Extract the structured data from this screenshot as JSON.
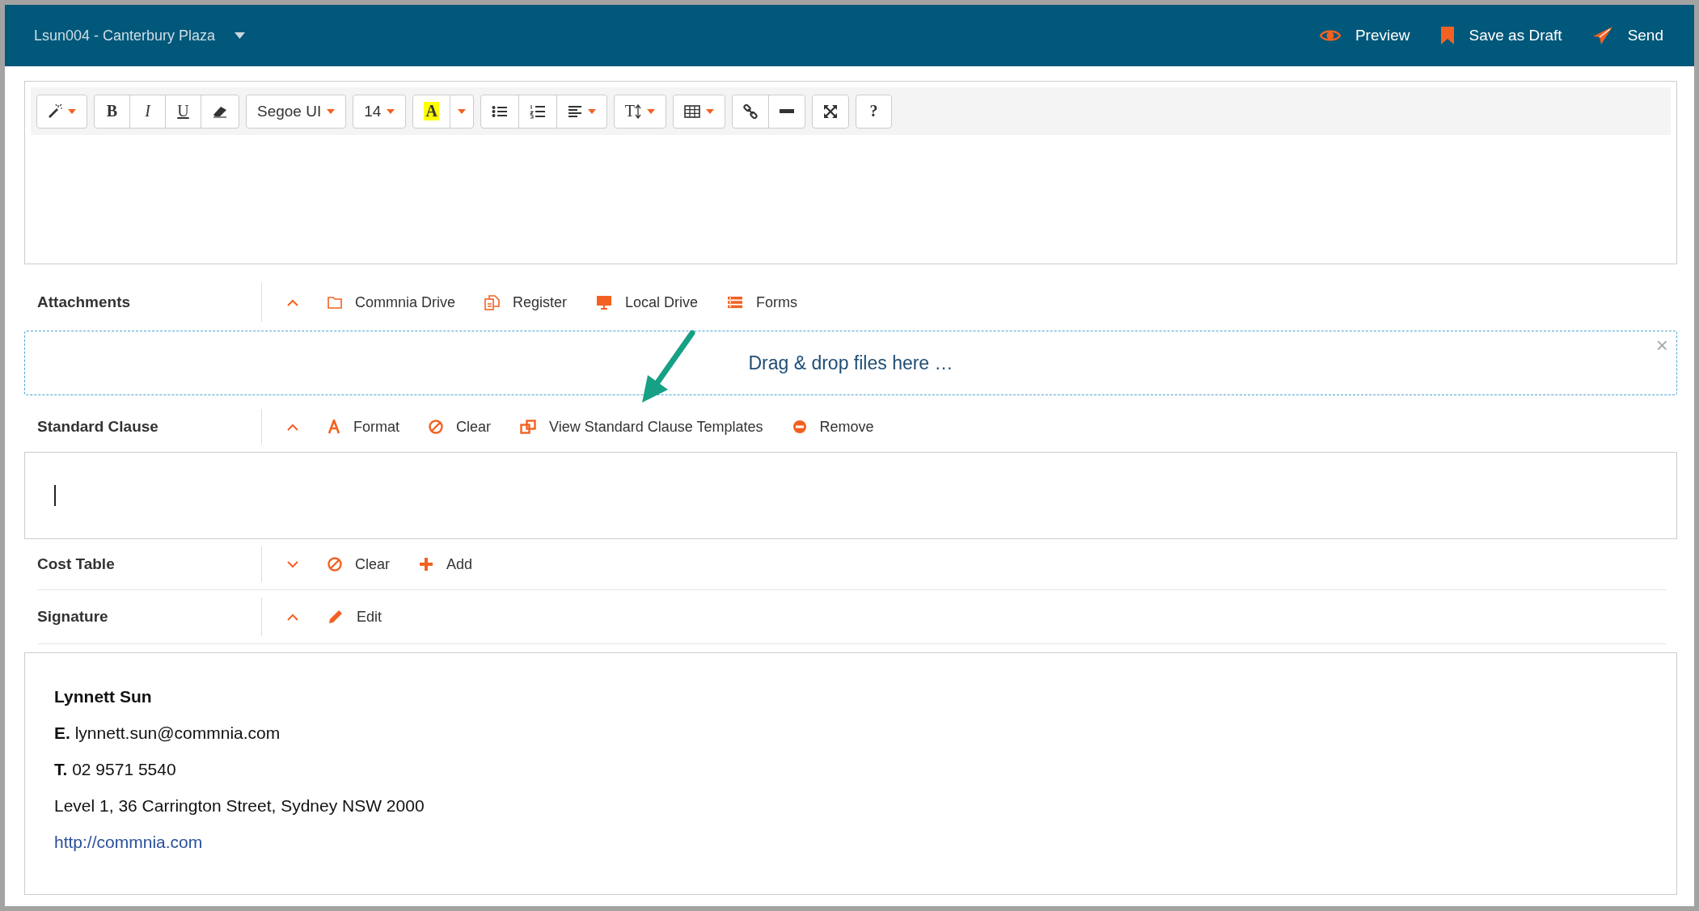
{
  "header": {
    "title": "Lsun004 - Canterbury Plaza",
    "actions": [
      {
        "kind": "preview",
        "label": "Preview"
      },
      {
        "kind": "draft",
        "label": "Save as Draft"
      },
      {
        "kind": "send",
        "label": "Send"
      }
    ]
  },
  "toolbar": [
    [
      {
        "kind": "magic",
        "dropdown": true
      }
    ],
    [
      {
        "kind": "bold",
        "label": "B"
      },
      {
        "kind": "italic",
        "label": "I"
      },
      {
        "kind": "underline",
        "label": "U"
      },
      {
        "kind": "eraser"
      }
    ],
    [
      {
        "kind": "font",
        "label": "Segoe UI",
        "dropdown": true
      }
    ],
    [
      {
        "kind": "size",
        "label": "14",
        "dropdown": true
      }
    ],
    [
      {
        "kind": "color",
        "label": "A",
        "color": "#ffff00"
      },
      {
        "kind": "caret"
      }
    ],
    [
      {
        "kind": "ul"
      },
      {
        "kind": "ol"
      },
      {
        "kind": "align",
        "dropdown": true
      }
    ],
    [
      {
        "kind": "lineheight",
        "label": "T",
        "dropdown": true
      }
    ],
    [
      {
        "kind": "table",
        "dropdown": true
      }
    ],
    [
      {
        "kind": "link"
      },
      {
        "kind": "hr"
      }
    ],
    [
      {
        "kind": "fullscreen"
      }
    ],
    [
      {
        "kind": "help",
        "label": "?"
      }
    ]
  ],
  "sections": [
    {
      "label": "Attachments",
      "expanded": true,
      "actions": [
        {
          "kind": "folder",
          "label": "Commnia Drive"
        },
        {
          "kind": "register",
          "label": "Register"
        },
        {
          "kind": "monitor",
          "label": "Local Drive"
        },
        {
          "kind": "forms",
          "label": "Forms"
        }
      ],
      "panel": {
        "kind": "dropzone",
        "text": "Drag & drop files here …",
        "close": "×"
      }
    },
    {
      "label": "Standard Clause",
      "expanded": true,
      "actions": [
        {
          "kind": "format",
          "label": "Format"
        },
        {
          "kind": "clear",
          "label": "Clear"
        },
        {
          "kind": "templates",
          "label": "View Standard Clause Templates"
        },
        {
          "kind": "remove",
          "label": "Remove"
        }
      ],
      "panel": {
        "kind": "editor",
        "cursor": true
      }
    },
    {
      "label": "Cost Table",
      "expanded": false,
      "actions": [
        {
          "kind": "clear",
          "label": "Clear"
        },
        {
          "kind": "add",
          "label": "Add"
        }
      ]
    },
    {
      "label": "Signature",
      "expanded": true,
      "actions": [
        {
          "kind": "edit",
          "label": "Edit"
        }
      ],
      "panel": {
        "kind": "signature",
        "lines": [
          {
            "kind": "name",
            "text": "Lynnett Sun"
          },
          {
            "kind": "text",
            "text": "**E.** lynnett.sun@commnia.com"
          },
          {
            "kind": "text",
            "text": "**T.** 02 9571 5540"
          },
          {
            "kind": "text",
            "text": "Level 1, 36 Carrington Street, Sydney NSW 2000"
          },
          {
            "kind": "link",
            "text": "http://commnia.com"
          }
        ]
      }
    }
  ]
}
